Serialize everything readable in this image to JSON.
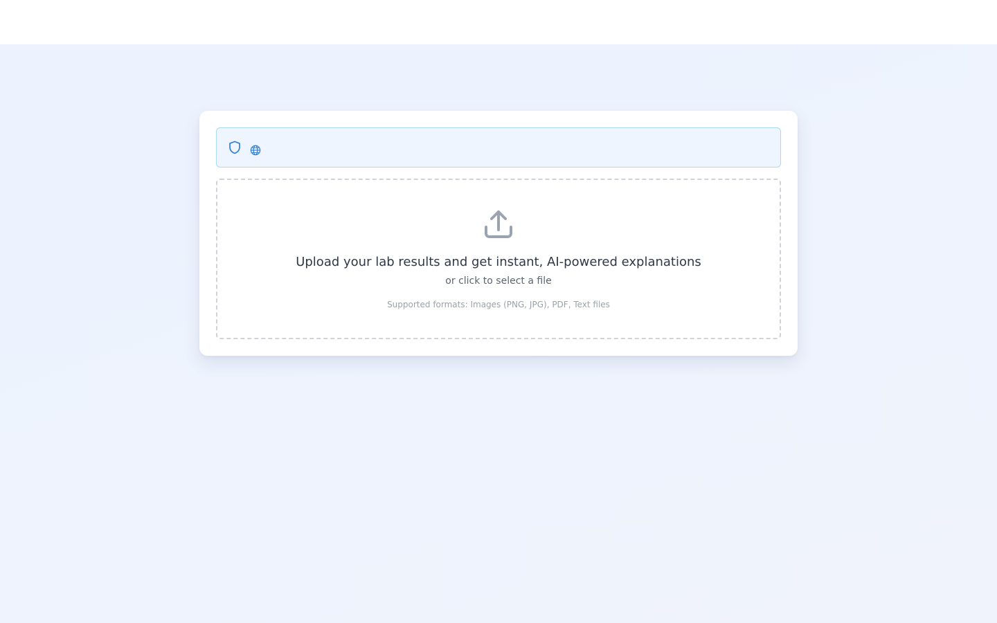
{
  "header": {},
  "notice": {
    "icons": [
      "shield-icon",
      "globe-icon"
    ],
    "accent_color": "#2f7fd6",
    "border_color": "#a9dbee",
    "background_color": "#eef5fe"
  },
  "upload": {
    "icon": "upload-icon",
    "headline": "Upload your lab results and get instant, AI-powered explanations",
    "subline": "or click to select a file",
    "formats": "Supported formats: Images (PNG, JPG), PDF, Text files"
  }
}
